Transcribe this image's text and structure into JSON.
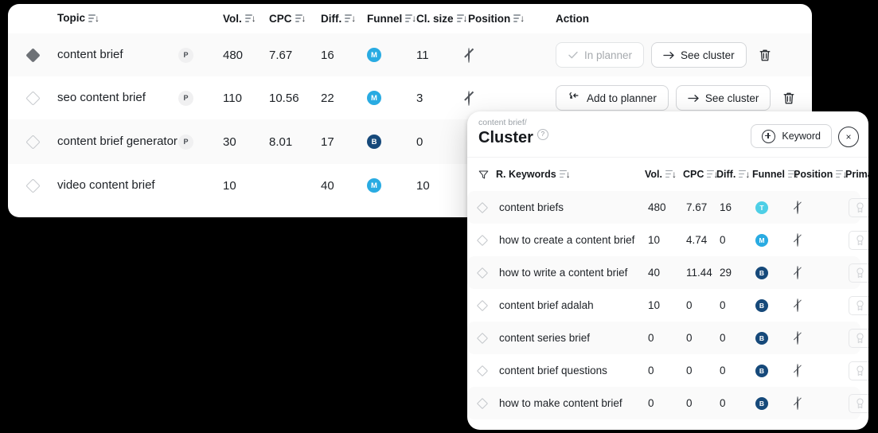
{
  "main_table": {
    "columns": [
      {
        "key": "topic",
        "label": "Topic",
        "sortable": true
      },
      {
        "key": "vol",
        "label": "Vol.",
        "sortable": true
      },
      {
        "key": "cpc",
        "label": "CPC",
        "sortable": true
      },
      {
        "key": "diff",
        "label": "Diff.",
        "sortable": true
      },
      {
        "key": "funnel",
        "label": "Funnel",
        "sortable": true
      },
      {
        "key": "clsize",
        "label": "Cl. size",
        "sortable": true
      },
      {
        "key": "position",
        "label": "Position",
        "sortable": true
      },
      {
        "key": "action",
        "label": "Action",
        "sortable": false
      }
    ],
    "rows": [
      {
        "marker": "diamond-filled",
        "topic": "content brief",
        "tag": "P",
        "vol": "480",
        "cpc": "7.67",
        "diff": "16",
        "funnel": "M",
        "funnel_color": "#29abe2",
        "clsize": "11",
        "position": "none",
        "planner_label": "In planner",
        "planner_state": "in",
        "cluster_label": "See cluster",
        "delete": "delete-icon"
      },
      {
        "marker": "diamond-outline",
        "topic": "seo content brief",
        "tag": "P",
        "vol": "110",
        "cpc": "10.56",
        "diff": "22",
        "funnel": "M",
        "funnel_color": "#29abe2",
        "clsize": "3",
        "position": "none",
        "planner_label": "Add to planner",
        "planner_state": "add",
        "cluster_label": "See cluster",
        "delete": "delete-icon"
      },
      {
        "marker": "diamond-outline",
        "topic": "content brief generator",
        "tag": "P",
        "vol": "30",
        "cpc": "8.01",
        "diff": "17",
        "funnel": "B",
        "funnel_color": "#16497a",
        "clsize": "0",
        "position": "none",
        "planner_label": "",
        "planner_state": "hidden",
        "cluster_label": "",
        "delete": ""
      },
      {
        "marker": "diamond-outline",
        "topic": "video content brief",
        "tag": "",
        "vol": "10",
        "cpc": "",
        "diff": "40",
        "funnel": "M",
        "funnel_color": "#29abe2",
        "clsize": "10",
        "position": "",
        "planner_label": "",
        "planner_state": "hidden",
        "cluster_label": "",
        "delete": ""
      }
    ]
  },
  "cluster_panel": {
    "breadcrumb": "content brief/",
    "title": "Cluster",
    "help": "?",
    "keyword_button": "Keyword",
    "close_button": "×",
    "columns": [
      {
        "key": "keywords",
        "label": "R. Keywords",
        "sortable": true
      },
      {
        "key": "vol",
        "label": "Vol.",
        "sortable": true
      },
      {
        "key": "cpc",
        "label": "CPC",
        "sortable": true
      },
      {
        "key": "diff",
        "label": "Diff.",
        "sortable": true
      },
      {
        "key": "funnel",
        "label": "Funnel",
        "sortable": true
      },
      {
        "key": "position",
        "label": "Position",
        "sortable": true
      },
      {
        "key": "primary",
        "label": "Primary",
        "sortable": false
      }
    ],
    "rows": [
      {
        "keyword": "content briefs",
        "vol": "480",
        "cpc": "7.67",
        "diff": "16",
        "funnel": "T",
        "funnel_color": "#4ecfe6",
        "position": "none",
        "primary": "award-icon"
      },
      {
        "keyword": "how to create a content brief",
        "vol": "10",
        "cpc": "4.74",
        "diff": "0",
        "funnel": "M",
        "funnel_color": "#29abe2",
        "position": "none",
        "primary": "award-icon"
      },
      {
        "keyword": "how to write a content brief",
        "vol": "40",
        "cpc": "11.44",
        "diff": "29",
        "funnel": "B",
        "funnel_color": "#16497a",
        "position": "none",
        "primary": "award-icon"
      },
      {
        "keyword": "content brief adalah",
        "vol": "10",
        "cpc": "0",
        "diff": "0",
        "funnel": "B",
        "funnel_color": "#16497a",
        "position": "none",
        "primary": "award-icon"
      },
      {
        "keyword": "content series brief",
        "vol": "0",
        "cpc": "0",
        "diff": "0",
        "funnel": "B",
        "funnel_color": "#16497a",
        "position": "none",
        "primary": "award-icon"
      },
      {
        "keyword": "content brief questions",
        "vol": "0",
        "cpc": "0",
        "diff": "0",
        "funnel": "B",
        "funnel_color": "#16497a",
        "position": "none",
        "primary": "award-icon"
      },
      {
        "keyword": "how to make content brief",
        "vol": "0",
        "cpc": "0",
        "diff": "0",
        "funnel": "B",
        "funnel_color": "#16497a",
        "position": "none",
        "primary": "award-icon"
      }
    ]
  },
  "colors": {
    "funnel_top": "#4ecfe6",
    "funnel_middle": "#29abe2",
    "funnel_bottom": "#16497a",
    "card_bg": "#ffffff",
    "row_alt": "#fafafa",
    "page_bg": "#000000"
  }
}
